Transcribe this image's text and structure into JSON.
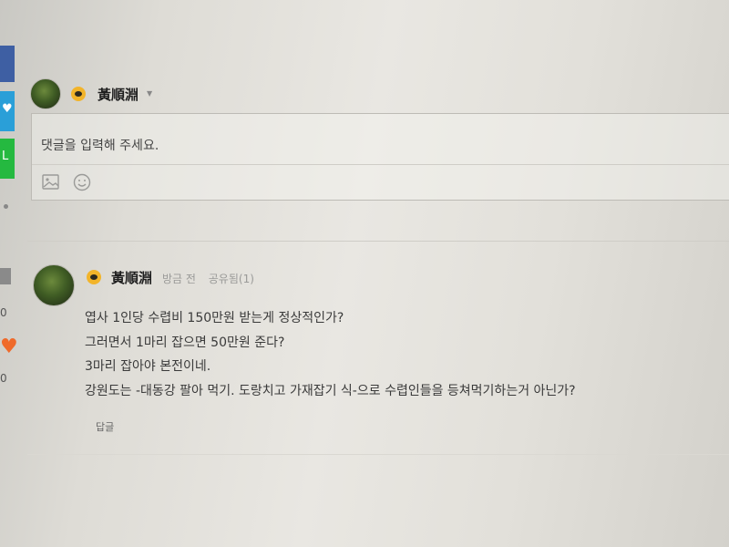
{
  "share": {
    "twitter_glyph": "♥",
    "line_glyph": "L",
    "count_top": "0",
    "count_bottom": "0",
    "colors": {
      "facebook": "#3e5fa3",
      "twitter": "#2a9fd8",
      "line": "#25b940",
      "heart": "#ef6a2a"
    }
  },
  "comment_writer": {
    "username": "黃順淵",
    "dropdown_glyph": "▼",
    "placeholder": "댓글을 입력해 주세요.",
    "tools": [
      "image-icon",
      "emoji-icon"
    ]
  },
  "comment": {
    "author": "黃順淵",
    "time": "방금 전",
    "share_label": "공유됨(1)",
    "lines": [
      "엽사 1인당 수렵비 150만원 받는게 정상적인가?",
      "그러면서 1마리 잡으면 50만원 준다?",
      "3마리 잡아야 본전이네.",
      "강원도는 -대동강 팔아 먹기. 도랑치고 가재잡기 식-으로 수렵인들을 등쳐먹기하는거 아닌가?"
    ],
    "reply_label": "답글"
  }
}
